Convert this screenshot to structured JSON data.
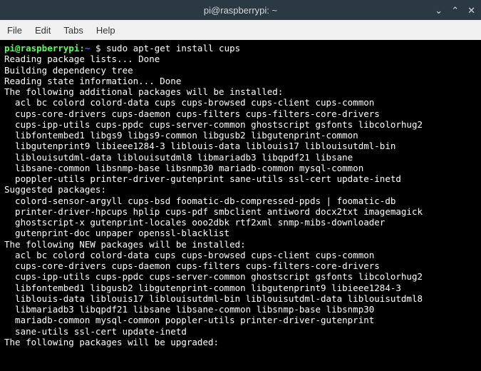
{
  "titlebar": {
    "title": "pi@raspberrypi: ~"
  },
  "menu": {
    "file": "File",
    "edit": "Edit",
    "tabs": "Tabs",
    "help": "Help"
  },
  "prompt": {
    "user_host": "pi@raspberrypi",
    "colon": ":",
    "path": "~",
    "dollar": " $ ",
    "command": "sudo apt-get install cups"
  },
  "output": {
    "line1": "Reading package lists... Done",
    "line2": "Building dependency tree",
    "line3": "Reading state information... Done",
    "line4": "The following additional packages will be installed:",
    "line5": "  acl bc colord colord-data cups cups-browsed cups-client cups-common",
    "line6": "  cups-core-drivers cups-daemon cups-filters cups-filters-core-drivers",
    "line7": "  cups-ipp-utils cups-ppdc cups-server-common ghostscript gsfonts libcolorhug2",
    "line8": "  libfontembed1 libgs9 libgs9-common libgusb2 libgutenprint-common",
    "line9": "  libgutenprint9 libieee1284-3 liblouis-data liblouis17 liblouisutdml-bin",
    "line10": "  liblouisutdml-data liblouisutdml8 libmariadb3 libqpdf21 libsane",
    "line11": "  libsane-common libsnmp-base libsnmp30 mariadb-common mysql-common",
    "line12": "  poppler-utils printer-driver-gutenprint sane-utils ssl-cert update-inetd",
    "line13": "Suggested packages:",
    "line14": "  colord-sensor-argyll cups-bsd foomatic-db-compressed-ppds | foomatic-db",
    "line15": "  printer-driver-hpcups hplip cups-pdf smbclient antiword docx2txt imagemagick",
    "line16": "  ghostscript-x gutenprint-locales ooo2dbk rtf2xml snmp-mibs-downloader",
    "line17": "  gutenprint-doc unpaper openssl-blacklist",
    "line18": "The following NEW packages will be installed:",
    "line19": "  acl bc colord colord-data cups cups-browsed cups-client cups-common",
    "line20": "  cups-core-drivers cups-daemon cups-filters cups-filters-core-drivers",
    "line21": "  cups-ipp-utils cups-ppdc cups-server-common ghostscript gsfonts libcolorhug2",
    "line22": "  libfontembed1 libgusb2 libgutenprint-common libgutenprint9 libieee1284-3",
    "line23": "  liblouis-data liblouis17 liblouisutdml-bin liblouisutdml-data liblouisutdml8",
    "line24": "  libmariadb3 libqpdf21 libsane libsane-common libsnmp-base libsnmp30",
    "line25": "  mariadb-common mysql-common poppler-utils printer-driver-gutenprint",
    "line26": "  sane-utils ssl-cert update-inetd",
    "line27": "The following packages will be upgraded:"
  }
}
